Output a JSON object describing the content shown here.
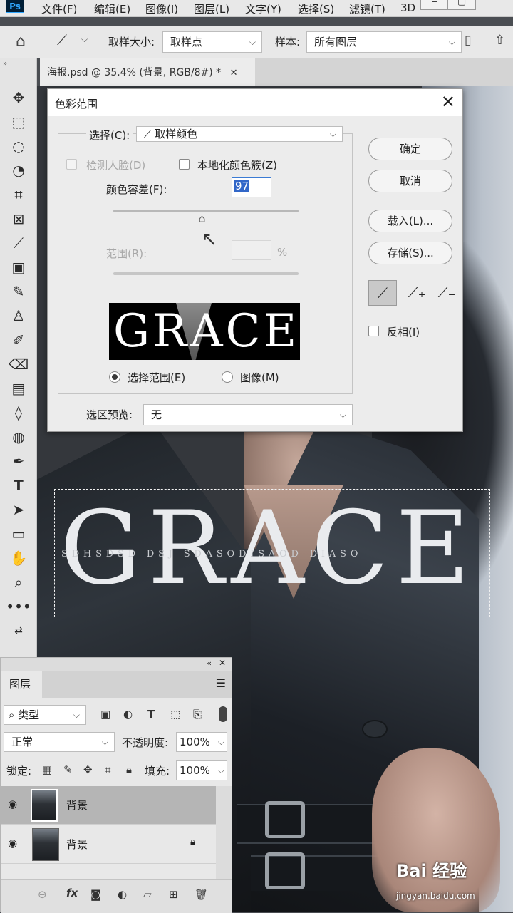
{
  "app": {
    "logo": "Ps"
  },
  "menu": [
    "文件(F)",
    "编辑(E)",
    "图像(I)",
    "图层(L)",
    "文字(Y)",
    "选择(S)",
    "滤镜(T)",
    "3D"
  ],
  "options": {
    "sample_size_label": "取样大小:",
    "sample_size_value": "取样点",
    "sample_label": "样本:",
    "sample_value": "所有图层"
  },
  "document": {
    "tab_title": "海报.psd @ 35.4% (背景, RGB/8#) *"
  },
  "canvas": {
    "big_text": "GRACE",
    "sub_text": "SDHSDSD DSJ SDASODISAOD DIASO"
  },
  "dialog": {
    "title": "色彩范围",
    "select_label": "选择(C):",
    "select_value": "取样颜色",
    "detect_faces": "检测人脸(D)",
    "localized": "本地化颜色簇(Z)",
    "fuzziness_label": "颜色容差(F):",
    "fuzziness_value": "97",
    "fuzziness_level": 0.49,
    "range_label": "范围(R):",
    "range_unit": "%",
    "preview_text": "GRACE",
    "radio_selection": "选择范围(E)",
    "radio_image": "图像(M)",
    "selection_preview_label": "选区预览:",
    "selection_preview_value": "无",
    "btn_ok": "确定",
    "btn_cancel": "取消",
    "btn_load": "载入(L)...",
    "btn_save": "存储(S)...",
    "invert": "反相(I)"
  },
  "layers_panel": {
    "tab": "图层",
    "filter": "类型",
    "blend_mode": "正常",
    "opacity_label": "不透明度:",
    "opacity_value": "100%",
    "lock_label": "锁定:",
    "fill_label": "填充:",
    "fill_value": "100%",
    "layers": [
      {
        "name": "背景"
      },
      {
        "name": "背景"
      }
    ]
  },
  "watermark": {
    "brand": "Bai 经验",
    "url": "jingyan.baidu.com"
  }
}
